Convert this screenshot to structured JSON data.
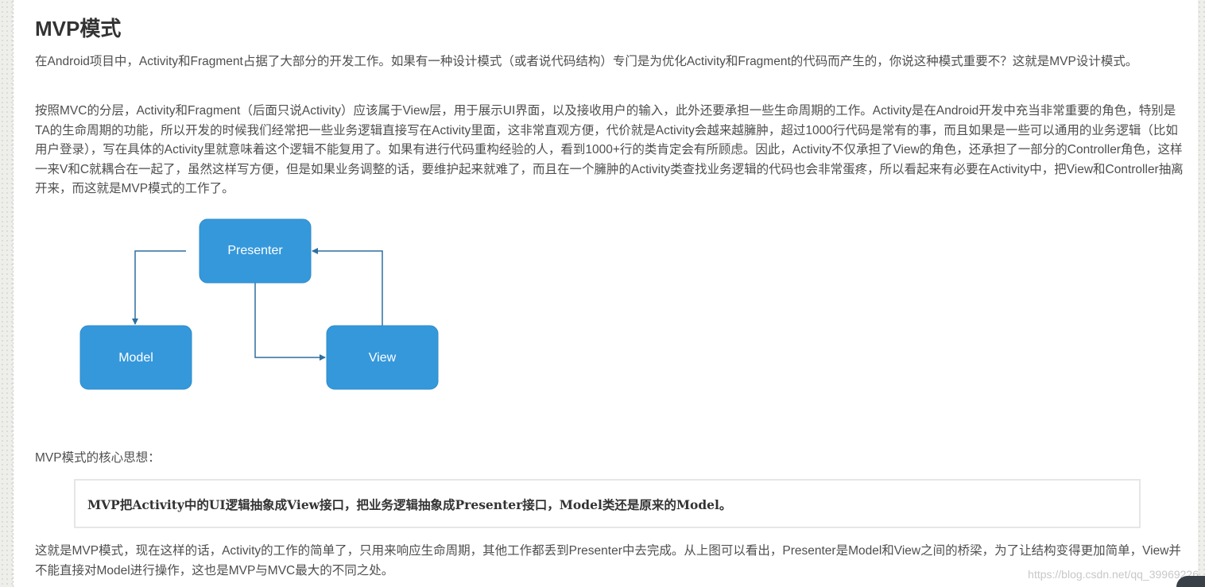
{
  "article": {
    "title": "MVP模式",
    "intro": "在Android项目中，Activity和Fragment占据了大部分的开发工作。如果有一种设计模式（或者说代码结构）专门是为优化Activity和Fragment的代码而产生的，你说这种模式重要不？这就是MVP设计模式。",
    "body": "按照MVC的分层，Activity和Fragment（后面只说Activity）应该属于View层，用于展示UI界面，以及接收用户的输入，此外还要承担一些生命周期的工作。Activity是在Android开发中充当非常重要的角色，特别是TA的生命周期的功能，所以开发的时候我们经常把一些业务逻辑直接写在Activity里面，这非常直观方便，代价就是Activity会越来越臃肿，超过1000行代码是常有的事，而且如果是一些可以通用的业务逻辑（比如用户登录），写在具体的Activity里就意味着这个逻辑不能复用了。如果有进行代码重构经验的人，看到1000+行的类肯定会有所顾虑。因此，Activity不仅承担了View的角色，还承担了一部分的Controller角色，这样一来V和C就耦合在一起了，虽然这样写方便，但是如果业务调整的话，要维护起来就难了，而且在一个臃肿的Activity类查找业务逻辑的代码也会非常蛋疼，所以看起来有必要在Activity中，把View和Controller抽离开来，而这就是MVP模式的工作了。",
    "core_label": "MVP模式的核心思想：",
    "quote": "MVP把Activity中的UI逻辑抽象成View接口，把业务逻辑抽象成Presenter接口，Model类还是原来的Model。",
    "summary": "这就是MVP模式，现在这样的话，Activity的工作的简单了，只用来响应生命周期，其他工作都丢到Presenter中去完成。从上图可以看出，Presenter是Model和View之间的桥梁，为了让结构变得更加简单，View并不能直接对Model进行操作，这也是MVP与MVC最大的不同之处。",
    "watermark": "https://blog.csdn.net/qq_39969226"
  },
  "diagram": {
    "presenter": "Presenter",
    "model": "Model",
    "view": "View",
    "box_color": "#3598db",
    "arrow_color": "#2e6f9e"
  }
}
